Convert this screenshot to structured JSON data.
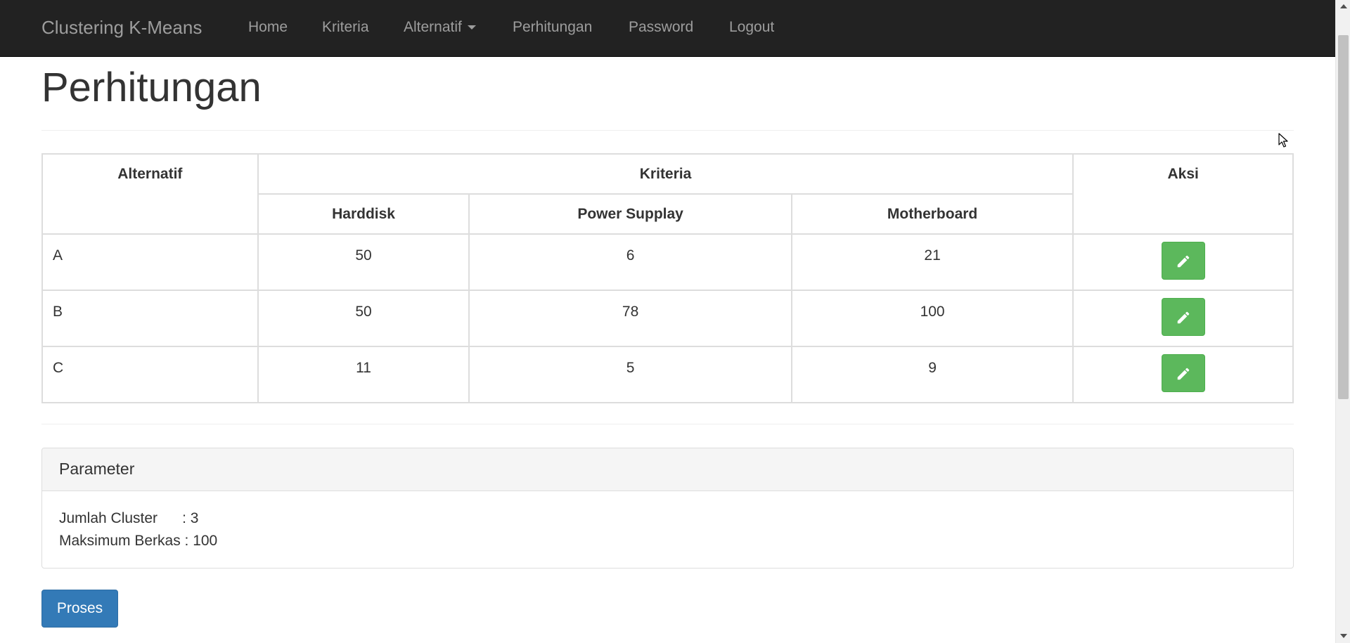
{
  "navbar": {
    "brand": "Clustering K-Means",
    "items": [
      {
        "label": "Home"
      },
      {
        "label": "Kriteria"
      },
      {
        "label": "Alternatif"
      },
      {
        "label": "Perhitungan"
      },
      {
        "label": "Password"
      },
      {
        "label": "Logout"
      }
    ],
    "background_color": "#222222",
    "text_color": "#9d9d9d",
    "alternatif_icon": "caret-down-icon"
  },
  "page": {
    "title": "Perhitungan"
  },
  "table": {
    "headers": {
      "alternatif": "Alternatif",
      "kriteria": "Kriteria",
      "aksi": "Aksi",
      "criteria": [
        "Harddisk",
        "Power Supplay",
        "Motherboard"
      ]
    },
    "rows": [
      {
        "name": "A",
        "values": [
          "50",
          "6",
          "21"
        ]
      },
      {
        "name": "B",
        "values": [
          "50",
          "78",
          "100"
        ]
      },
      {
        "name": "C",
        "values": [
          "11",
          "5",
          "9"
        ]
      }
    ],
    "edit_icon": "pencil-icon",
    "edit_button_color": "#5cb85c"
  },
  "panel": {
    "heading": "Parameter",
    "lines": [
      {
        "label": "Jumlah Cluster      ",
        "value": ": 3"
      },
      {
        "label": "Maksimum Berkas ",
        "value": ": 100"
      }
    ]
  },
  "process_button": {
    "label": "Proses",
    "color": "#337ab7"
  }
}
